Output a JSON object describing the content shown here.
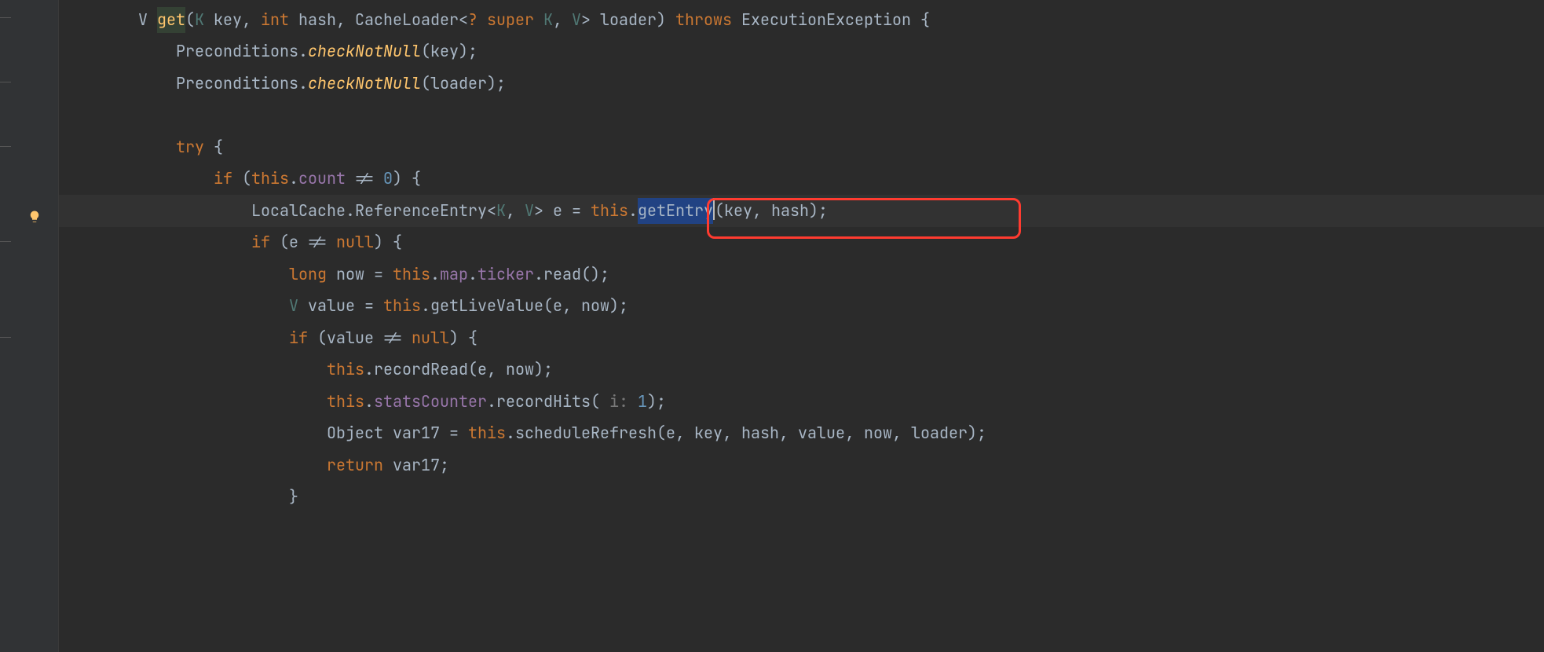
{
  "code": {
    "l1": {
      "t1": "V ",
      "t2": "get",
      "t3": "(",
      "t4": "K",
      "t5": " key, ",
      "t6": "int",
      "t7": " hash, CacheLoader<",
      "t8": "?",
      "t9": " ",
      "t10": "super",
      "t11": " ",
      "t12": "K",
      "t13": ", ",
      "t14": "V",
      "t15": "> loader) ",
      "t16": "throws",
      "t17": " ExecutionException {"
    },
    "l2": {
      "t1": "Preconditions.",
      "t2": "checkNotNull",
      "t3": "(key);"
    },
    "l3": {
      "t1": "Preconditions.",
      "t2": "checkNotNull",
      "t3": "(loader);"
    },
    "l4": {
      "t1": ""
    },
    "l5": {
      "t1": "try",
      "t2": " {"
    },
    "l6": {
      "t1": "if",
      "t2": " (",
      "t3": "this",
      "t4": ".",
      "t5": "count",
      "t6": " != ",
      "t7": "0",
      "t8": ") {"
    },
    "l7": {
      "t1": "LocalCache.ReferenceEntry<",
      "t2": "K",
      "t3": ", ",
      "t4": "V",
      "t5": "> e = ",
      "t6": "this",
      "t7": ".",
      "t8": "getEntry",
      "t9": "(key, hash);"
    },
    "l8": {
      "t1": "if",
      "t2": " (e != ",
      "t3": "null",
      "t4": ") {"
    },
    "l9": {
      "t1": "long",
      "t2": " now = ",
      "t3": "this",
      "t4": ".",
      "t5": "map",
      "t6": ".",
      "t7": "ticker",
      "t8": ".read();"
    },
    "l10": {
      "t1": "V",
      "t2": " value = ",
      "t3": "this",
      "t4": ".getLiveValue(e, now);"
    },
    "l11": {
      "t1": "if",
      "t2": " (value != ",
      "t3": "null",
      "t4": ") {"
    },
    "l12": {
      "t1": "this",
      "t2": ".recordRead(e, now);"
    },
    "l13": {
      "t1": "this",
      "t2": ".",
      "t3": "statsCounter",
      "t4": ".recordHits(",
      "t5": " i: ",
      "t6": "1",
      "t7": ");"
    },
    "l14": {
      "t1": "Object var17 = ",
      "t2": "this",
      "t3": ".scheduleRefresh(e, key, hash, value, now, loader);"
    },
    "l15": {
      "t1": "return",
      "t2": " var17;"
    },
    "l16": {
      "t1": "}"
    }
  },
  "indent": {
    "l1": "   ",
    "l2": "       ",
    "l3": "       ",
    "l4": "",
    "l5": "       ",
    "l6": "           ",
    "l7": "               ",
    "l8": "               ",
    "l9": "                   ",
    "l10": "                   ",
    "l11": "                   ",
    "l12": "                       ",
    "l13": "                       ",
    "l14": "                       ",
    "l15": "                       ",
    "l16": "                   "
  }
}
